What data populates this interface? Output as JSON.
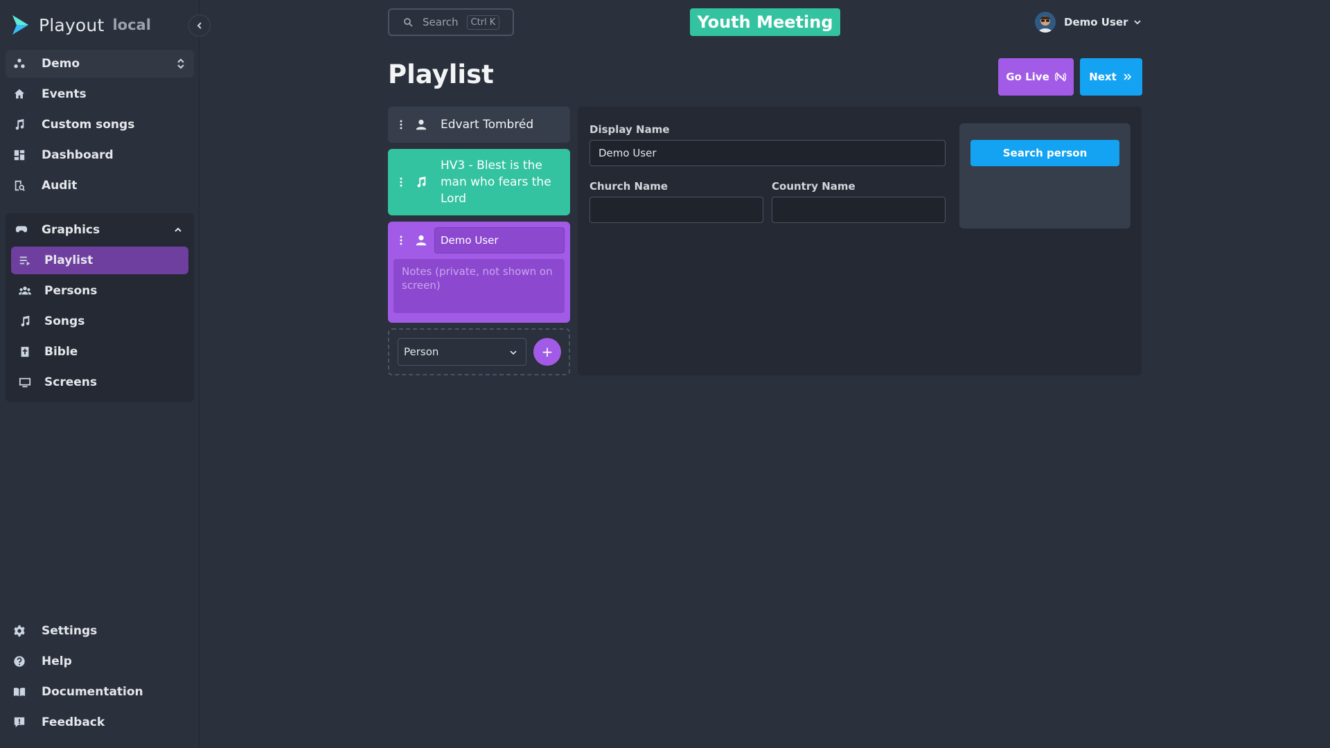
{
  "app": {
    "name": "Playout",
    "env": "local"
  },
  "sidebar": {
    "project": "Demo",
    "nav": [
      {
        "label": "Events",
        "icon": "home-icon"
      },
      {
        "label": "Custom songs",
        "icon": "music-note-icon"
      },
      {
        "label": "Dashboard",
        "icon": "dashboard-icon"
      },
      {
        "label": "Audit",
        "icon": "audit-icon"
      }
    ],
    "graphics": {
      "label": "Graphics",
      "items": [
        {
          "label": "Playlist",
          "icon": "playlist-icon",
          "active": true
        },
        {
          "label": "Persons",
          "icon": "people-icon"
        },
        {
          "label": "Songs",
          "icon": "music-note-icon"
        },
        {
          "label": "Bible",
          "icon": "bible-icon"
        },
        {
          "label": "Screens",
          "icon": "monitor-icon"
        }
      ]
    },
    "footer": [
      {
        "label": "Settings",
        "icon": "gear-icon"
      },
      {
        "label": "Help",
        "icon": "help-icon"
      },
      {
        "label": "Documentation",
        "icon": "book-icon"
      },
      {
        "label": "Feedback",
        "icon": "feedback-icon"
      }
    ]
  },
  "topbar": {
    "search_placeholder": "Search",
    "search_shortcut": "Ctrl K",
    "event_title": "Youth Meeting",
    "event_color": "#34c3a0",
    "user_name": "Demo User"
  },
  "page": {
    "title": "Playlist",
    "go_live_label": "Go Live",
    "next_label": "Next"
  },
  "playlist": {
    "items": [
      {
        "type": "person",
        "text": "Edvart Tombréd"
      },
      {
        "type": "song",
        "text": "HV3 - Blest is the man who fears the Lord"
      },
      {
        "type": "person",
        "text": "Demo User",
        "notes_placeholder": "Notes (private, not shown on screen)",
        "active": true
      }
    ],
    "add_type": "Person",
    "add_label": "+"
  },
  "editor": {
    "display_name_label": "Display Name",
    "display_name_value": "Demo User",
    "church_name_label": "Church Name",
    "church_name_value": "",
    "country_name_label": "Country Name",
    "country_name_value": "",
    "search_person_label": "Search person"
  },
  "colors": {
    "accent_purple": "#a25be6",
    "accent_blue": "#14a3f2",
    "accent_green": "#34c3a0",
    "active_nav": "#6e3f9e"
  }
}
